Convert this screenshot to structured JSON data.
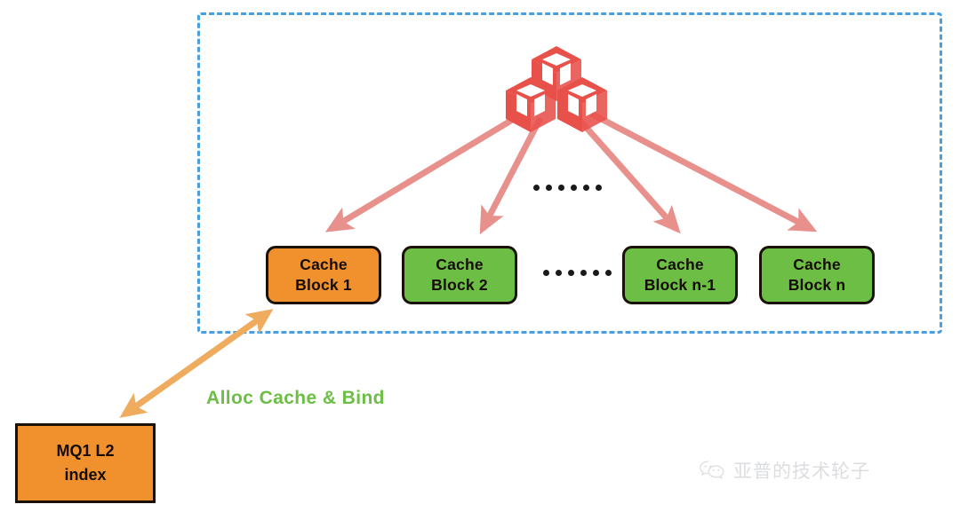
{
  "diagram": {
    "title_label": "Alloc Cache & Bind",
    "region": {
      "name": "cache-pool-region",
      "border_color": "#4a9fe0",
      "style": "dashed"
    },
    "source_icon": {
      "name": "red-cubes-icon",
      "color": "#e8504a",
      "cube_count": 3
    },
    "cache_blocks": [
      {
        "line1": "Cache",
        "line2": "Block 1",
        "color": "#f0912d"
      },
      {
        "line1": "Cache",
        "line2": "Block 2",
        "color": "#6cbe45"
      },
      {
        "line1": "Cache",
        "line2": "Block n-1",
        "color": "#6cbe45"
      },
      {
        "line1": "Cache",
        "line2": "Block n",
        "color": "#6cbe45"
      }
    ],
    "ellipsis": {
      "top": "......",
      "middle": "......",
      "dot_count": 6
    },
    "index_box": {
      "line1": "MQ1 L2",
      "line2": "index",
      "color": "#f0912d"
    },
    "arrows": {
      "fanout_color": "#e8908c",
      "bind_color": "#efab5e",
      "fanout_count": 4,
      "bind_label": "Alloc Cache & Bind"
    }
  },
  "watermark": {
    "icon": "wechat-icon",
    "text": "亚普的技术轮子",
    "color": "#b9bcc2"
  }
}
